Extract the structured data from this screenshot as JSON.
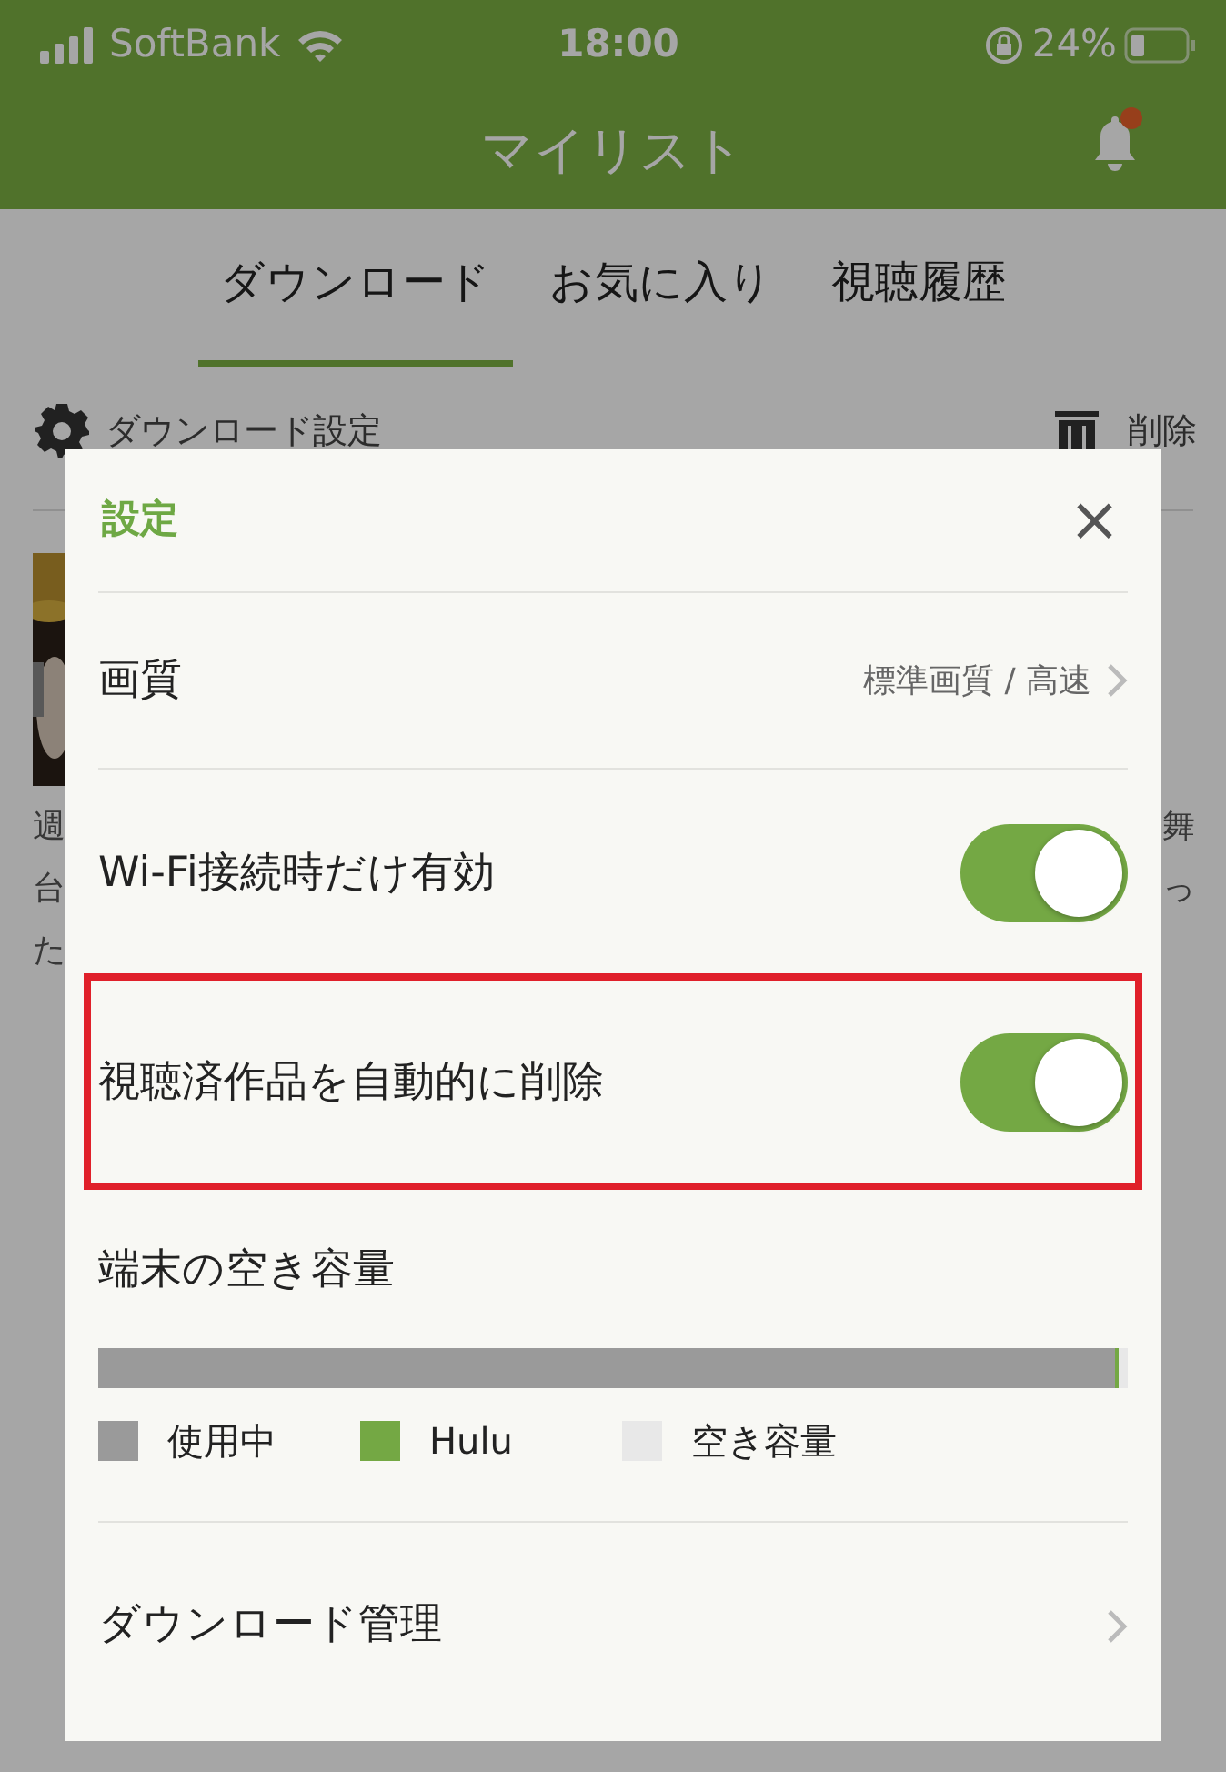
{
  "status_bar": {
    "carrier": "SoftBank",
    "time": "18:00",
    "battery": "24%"
  },
  "header": {
    "title": "マイリスト",
    "notification_badge": true
  },
  "tabs": [
    {
      "label": "ダウンロード",
      "selected": true
    },
    {
      "label": "お気に入り",
      "selected": false
    },
    {
      "label": "視聴履歴",
      "selected": false
    }
  ],
  "toolbar": {
    "settings_label": "ダウンロード設定",
    "delete_label": "削除"
  },
  "background_item": {
    "lines": [
      {
        "left": "週",
        "right": "舞"
      },
      {
        "left": "台",
        "right": "っ"
      },
      {
        "left": "た"
      }
    ]
  },
  "dialog": {
    "title": "設定",
    "close": "×",
    "rows": [
      {
        "kind": "link",
        "label": "画質",
        "value": "標準画質 / 高速",
        "highlighted": false
      },
      {
        "kind": "toggle",
        "label": "Wi-Fi接続時だけ有効",
        "on": true,
        "highlighted": false
      },
      {
        "kind": "toggle",
        "label": "視聴済作品を自動的に削除",
        "on": true,
        "highlighted": true
      },
      {
        "kind": "storage",
        "label": "端末の空き容量",
        "highlighted": false,
        "segments": [
          {
            "name": "使用中",
            "color": "#9a9a9a",
            "level": 0.988
          },
          {
            "name": "Hulu",
            "color": "#74a844",
            "level": 0.003
          },
          {
            "name": "空き容量",
            "color": "#e8e8e8",
            "level": 0.009
          }
        ]
      },
      {
        "kind": "link",
        "label": "ダウンロード管理",
        "highlighted": false
      }
    ]
  }
}
